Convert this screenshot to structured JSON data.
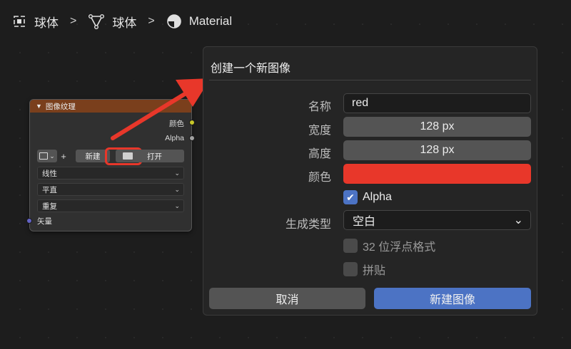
{
  "breadcrumb": {
    "items": [
      {
        "label": "球体",
        "icon": "object-icon"
      },
      {
        "label": "球体",
        "icon": "mesh-icon"
      },
      {
        "label": "Material",
        "icon": "material-icon"
      }
    ],
    "separator": ">"
  },
  "node": {
    "title": "图像纹理",
    "outputs": {
      "color": "颜色",
      "alpha": "Alpha"
    },
    "new_label": "新建",
    "open_label": "打开",
    "plus_label": "+",
    "dropdowns": [
      "线性",
      "平直",
      "重复"
    ],
    "input_vector": "矢量",
    "colors": {
      "header": "#7a3f1c",
      "color_socket": "#c7c729",
      "alpha_socket": "#a1a1a1",
      "vector_socket": "#6363c7"
    }
  },
  "dialog": {
    "title": "创建一个新图像",
    "name_label": "名称",
    "name_value": "red",
    "width_label": "宽度",
    "width_value": "128 px",
    "height_label": "高度",
    "height_value": "128 px",
    "color_label": "颜色",
    "color_value": "#e8372a",
    "alpha_label": "Alpha",
    "alpha_checked": true,
    "gen_type_label": "生成类型",
    "gen_type_value": "空白",
    "float_label": "32 位浮点格式",
    "float_checked": false,
    "tiled_label": "拼贴",
    "tiled_checked": false,
    "cancel_label": "取消",
    "ok_label": "新建图像",
    "accent_color": "#4c73c4"
  },
  "annotation": {
    "highlight_color": "#e8372a"
  }
}
